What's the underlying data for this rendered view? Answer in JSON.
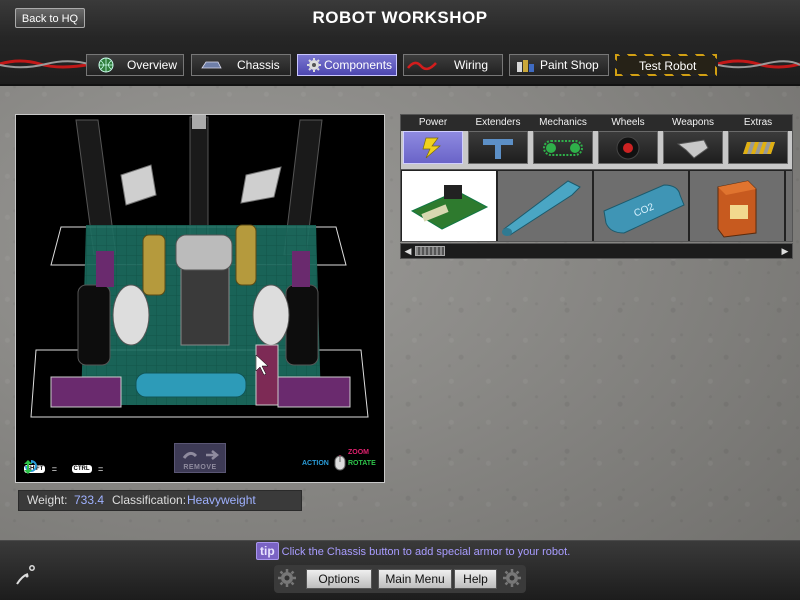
{
  "app": {
    "title": "ROBOT WORKSHOP",
    "back_label": "Back to HQ"
  },
  "tabs": [
    {
      "label": "Overview",
      "icon": "globe-icon"
    },
    {
      "label": "Chassis",
      "icon": "chassis-icon"
    },
    {
      "label": "Components",
      "icon": "gear-icon",
      "active": true
    },
    {
      "label": "Wiring",
      "icon": "wire-icon"
    },
    {
      "label": "Paint Shop",
      "icon": "paint-icon"
    },
    {
      "label": "Test Robot",
      "icon": "hazard-icon"
    }
  ],
  "viewport": {
    "legend": {
      "shift": "SHIFT",
      "ctrl": "CTRL",
      "equals": "="
    },
    "remove_label": "REMOVE",
    "mouse": {
      "zoom": "ZOOM",
      "action": "ACTION",
      "rotate": "ROTATE"
    }
  },
  "status": {
    "weight_label": "Weight:",
    "weight_value": "733.4",
    "class_label": "Classification:",
    "class_value": "Heavyweight"
  },
  "categories": [
    {
      "label": "Power",
      "icon": "lightning-icon",
      "active": true
    },
    {
      "label": "Extenders",
      "icon": "extender-icon"
    },
    {
      "label": "Mechanics",
      "icon": "chain-icon"
    },
    {
      "label": "Wheels",
      "icon": "wheel-icon"
    },
    {
      "label": "Weapons",
      "icon": "blade-icon"
    },
    {
      "label": "Extras",
      "icon": "extras-icon"
    }
  ],
  "items": [
    {
      "name": "circuit-board",
      "selected": true
    },
    {
      "name": "blue-cylinder-tank"
    },
    {
      "name": "co2-tank",
      "text": "CO2"
    },
    {
      "name": "battery-box"
    }
  ],
  "tip": {
    "badge": "tip",
    "text": "Click the Chassis button to add special armor to your robot."
  },
  "bottom": {
    "options": "Options",
    "main_menu": "Main Menu",
    "help": "Help"
  },
  "colors": {
    "accent": "#6a64c8",
    "tip_text": "#a89cff",
    "status_value": "#9fb1ff"
  }
}
